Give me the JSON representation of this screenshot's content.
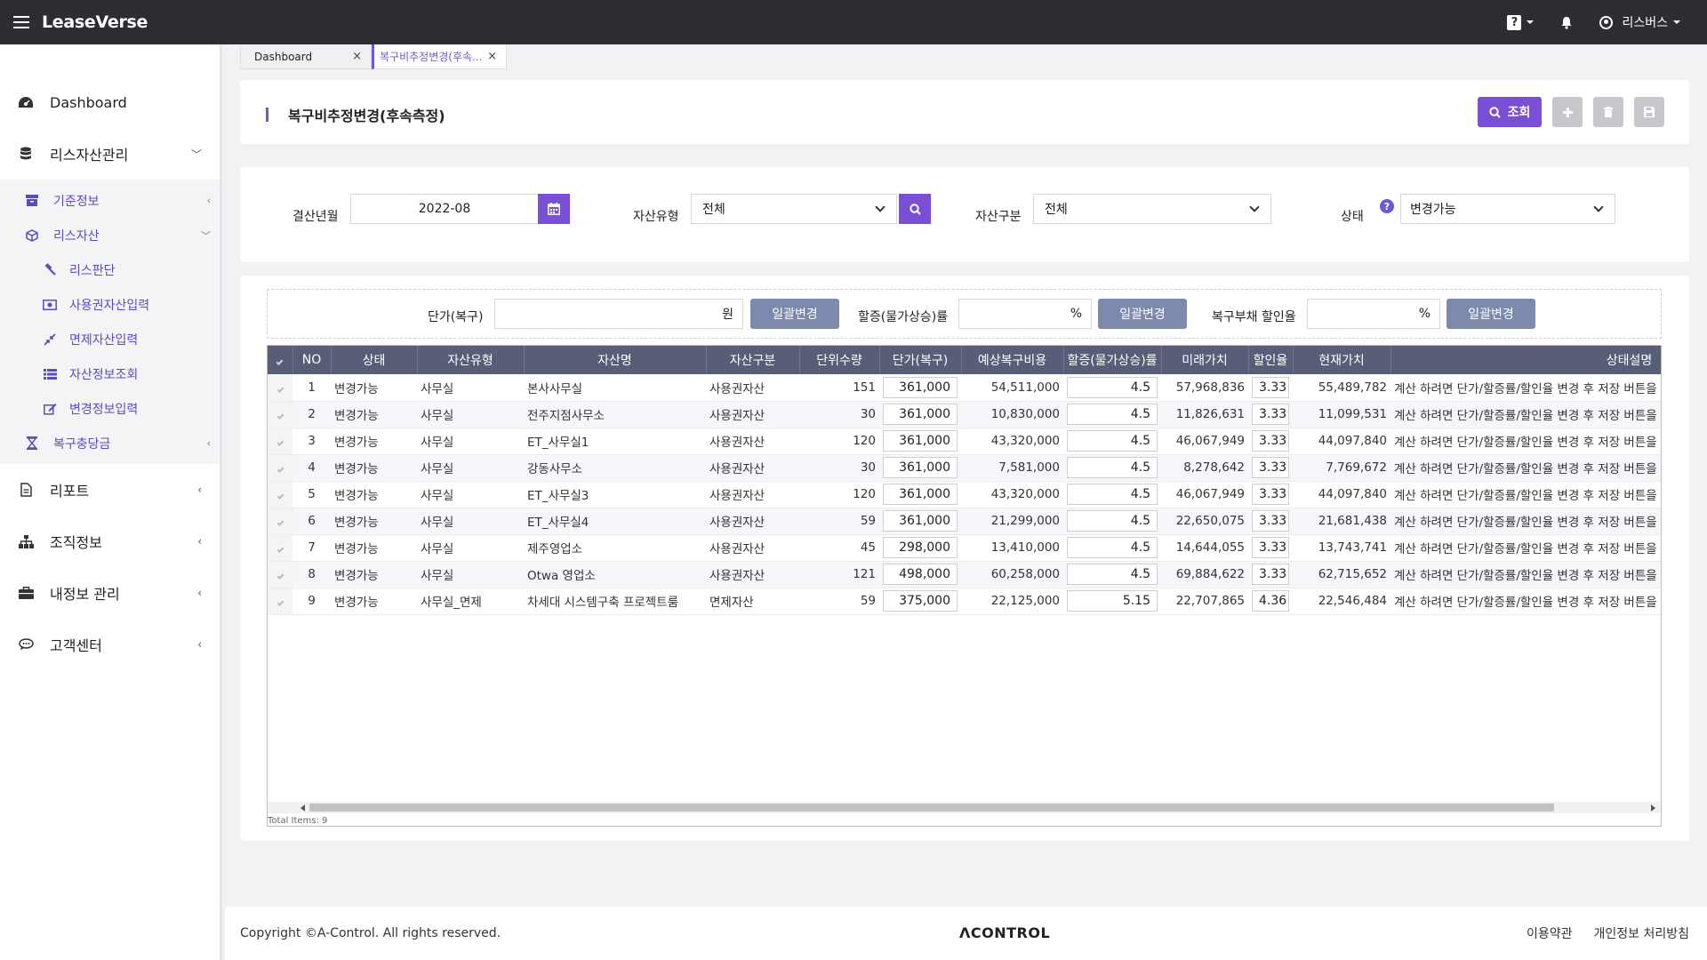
{
  "app": {
    "brand": "LeaseVerse",
    "user": "리스버스",
    "help_label": "?"
  },
  "sidebar": {
    "items": [
      {
        "label": "Dashboard"
      },
      {
        "label": "리스자산관리"
      },
      {
        "label": "리포트"
      },
      {
        "label": "조직정보"
      },
      {
        "label": "내정보 관리"
      },
      {
        "label": "고객센터"
      }
    ],
    "sub": [
      {
        "label": "기준정보"
      },
      {
        "label": "리스자산"
      },
      {
        "label": "복구충당금"
      }
    ],
    "sub2": [
      {
        "label": "리스판단"
      },
      {
        "label": "사용권자산입력"
      },
      {
        "label": "면제자산입력"
      },
      {
        "label": "자산정보조회"
      },
      {
        "label": "변경정보입력"
      }
    ]
  },
  "tabs": [
    {
      "label": "Dashboard",
      "close": "×"
    },
    {
      "label": "복구비추정변경(후속...",
      "close": "×"
    }
  ],
  "page": {
    "title": "복구비추정변경(후속측정)",
    "search_button": "조회"
  },
  "filters": {
    "period_label": "결산년월",
    "period_value": "2022-08",
    "asset_type_label": "자산유형",
    "asset_type_value": "전체",
    "asset_class_label": "자산구분",
    "asset_class_value": "전체",
    "status_label": "상태",
    "status_value": "변경가능"
  },
  "bulk": {
    "unit_price_label": "단가(복구)",
    "unit_price_suffix": "원",
    "rate_label": "할증(물가상승)률",
    "rate_suffix": "%",
    "discount_label": "복구부채 할인율",
    "discount_suffix": "%",
    "apply_button": "일괄변경"
  },
  "grid": {
    "columns": [
      "NO",
      "상태",
      "자산유형",
      "자산명",
      "자산구분",
      "단위수량",
      "단가(복구)",
      "예상복구비용",
      "할증(물가상승)률",
      "미래가치",
      "할인율",
      "현재가치",
      "상태설명"
    ],
    "rows": [
      {
        "no": "1",
        "status": "변경가능",
        "type": "사무실",
        "name": "본사사무실",
        "class": "사용권자산",
        "qty": "151",
        "price": "361,000",
        "cost": "54,511,000",
        "rate": "4.5",
        "future": "57,968,836",
        "disc": "3.33",
        "present": "55,489,782",
        "desc": "계산 하려면 단가/할증률/할인율 변경 후 저장 버튼을 클릭하세요"
      },
      {
        "no": "2",
        "status": "변경가능",
        "type": "사무실",
        "name": "전주지점사무소",
        "class": "사용권자산",
        "qty": "30",
        "price": "361,000",
        "cost": "10,830,000",
        "rate": "4.5",
        "future": "11,826,631",
        "disc": "3.33",
        "present": "11,099,531",
        "desc": "계산 하려면 단가/할증률/할인율 변경 후 저장 버튼을 클릭하세요"
      },
      {
        "no": "3",
        "status": "변경가능",
        "type": "사무실",
        "name": "ET_사무실1",
        "class": "사용권자산",
        "qty": "120",
        "price": "361,000",
        "cost": "43,320,000",
        "rate": "4.5",
        "future": "46,067,949",
        "disc": "3.33",
        "present": "44,097,840",
        "desc": "계산 하려면 단가/할증률/할인율 변경 후 저장 버튼을 클릭하세요"
      },
      {
        "no": "4",
        "status": "변경가능",
        "type": "사무실",
        "name": "강동사무소",
        "class": "사용권자산",
        "qty": "30",
        "price": "361,000",
        "cost": "7,581,000",
        "rate": "4.5",
        "future": "8,278,642",
        "disc": "3.33",
        "present": "7,769,672",
        "desc": "계산 하려면 단가/할증률/할인율 변경 후 저장 버튼을 클릭하세요"
      },
      {
        "no": "5",
        "status": "변경가능",
        "type": "사무실",
        "name": "ET_사무실3",
        "class": "사용권자산",
        "qty": "120",
        "price": "361,000",
        "cost": "43,320,000",
        "rate": "4.5",
        "future": "46,067,949",
        "disc": "3.33",
        "present": "44,097,840",
        "desc": "계산 하려면 단가/할증률/할인율 변경 후 저장 버튼을 클릭하세요"
      },
      {
        "no": "6",
        "status": "변경가능",
        "type": "사무실",
        "name": "ET_사무실4",
        "class": "사용권자산",
        "qty": "59",
        "price": "361,000",
        "cost": "21,299,000",
        "rate": "4.5",
        "future": "22,650,075",
        "disc": "3.33",
        "present": "21,681,438",
        "desc": "계산 하려면 단가/할증률/할인율 변경 후 저장 버튼을 클릭하세요"
      },
      {
        "no": "7",
        "status": "변경가능",
        "type": "사무실",
        "name": "제주영업소",
        "class": "사용권자산",
        "qty": "45",
        "price": "298,000",
        "cost": "13,410,000",
        "rate": "4.5",
        "future": "14,644,055",
        "disc": "3.33",
        "present": "13,743,741",
        "desc": "계산 하려면 단가/할증률/할인율 변경 후 저장 버튼을 클릭하세요"
      },
      {
        "no": "8",
        "status": "변경가능",
        "type": "사무실",
        "name": "Otwa 영업소",
        "class": "사용권자산",
        "qty": "121",
        "price": "498,000",
        "cost": "60,258,000",
        "rate": "4.5",
        "future": "69,884,622",
        "disc": "3.33",
        "present": "62,715,652",
        "desc": "계산 하려면 단가/할증률/할인율 변경 후 저장 버튼을 클릭하세요"
      },
      {
        "no": "9",
        "status": "변경가능",
        "type": "사무실_면제",
        "name": "차세대 시스템구축 프로젝트룸",
        "class": "면제자산",
        "qty": "59",
        "price": "375,000",
        "cost": "22,125,000",
        "rate": "5.15",
        "future": "22,707,865",
        "disc": "4.36",
        "present": "22,546,484",
        "desc": "계산 하려면 단가/할증률/할인율 변경 후 저장 버튼을 클릭하세요"
      }
    ],
    "total": "Total Items: 9"
  },
  "footer": {
    "copyright": "Copyright ©A-Control. All rights reserved.",
    "logo": "ΛCONTROL",
    "terms": "이용약관",
    "privacy": "개인정보 처리방침"
  },
  "colors": {
    "accent": "#7a4fd8",
    "topbar": "#2e2d33",
    "grid_header": "#585d78",
    "bulk_button": "#7e8aad"
  }
}
